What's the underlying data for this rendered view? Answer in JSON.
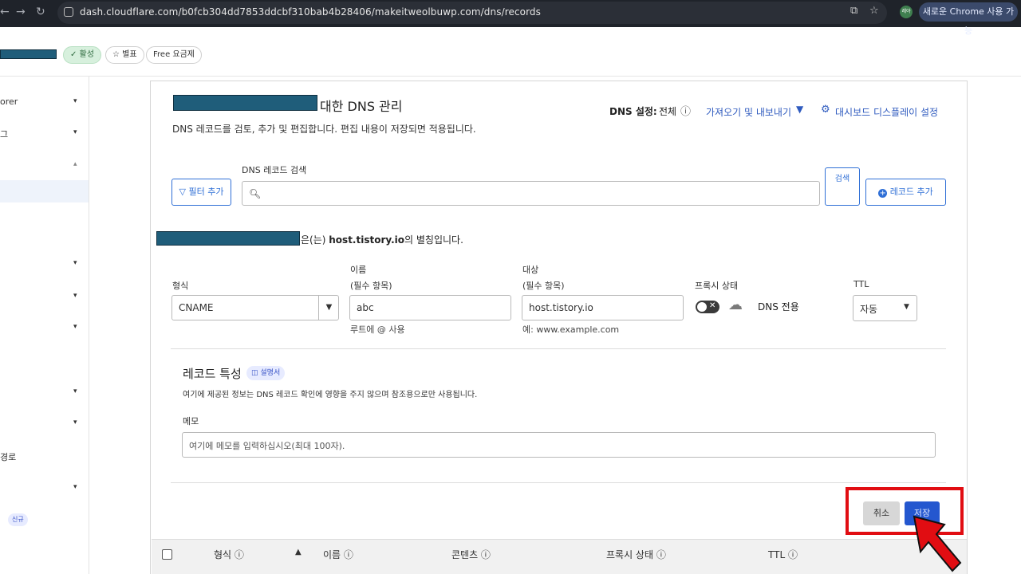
{
  "browser": {
    "url": "dash.cloudflare.com/b0fcb304dd7853ddcbf310bab4b28406/makeitweolbuwp.com/dns/records",
    "profile_initials": "레야",
    "new_chrome_label": "새로운 Chrome 사용 가능"
  },
  "header": {
    "status_active": "✓ 활성",
    "star_label": "☆ 별표",
    "plan_label": "Free 요금제"
  },
  "sidebar": {
    "items": [
      {
        "label": "orer",
        "caret": "▾"
      },
      {
        "label": "그",
        "caret": "▾"
      },
      {
        "label": "",
        "caret": "▴"
      },
      {
        "label": "",
        "caret": "▾"
      },
      {
        "label": "",
        "caret": "▾"
      },
      {
        "label": "",
        "caret": "▾"
      },
      {
        "label": "",
        "caret": "▾"
      },
      {
        "label": "",
        "caret": "▾"
      },
      {
        "label": "경로",
        "caret": ""
      },
      {
        "label": "",
        "caret": "▾"
      }
    ],
    "new_badge": "신규"
  },
  "dns": {
    "title_suffix": "대한 DNS 관리",
    "description": "DNS 레코드를 검토, 추가 및 편집합니다. 편집 내용이 저장되면 적용됩니다.",
    "settings_label": "DNS 설정:",
    "settings_value": "전체",
    "import_export": "가져오기 및 내보내기",
    "dashboard_display": "대시보드 디스플레이 설정",
    "filter_button": "필터 추가",
    "search_label": "DNS 레코드 검색",
    "search_button": "검색",
    "add_record": "레코드 추가",
    "alias_middle": "은(는) ",
    "alias_host": "host.tistory.io",
    "alias_end": "의 별칭입니다."
  },
  "form": {
    "type_label": "형식",
    "type_value": "CNAME",
    "name_label": "이름",
    "name_required": "(필수 항목)",
    "name_value": "abc",
    "name_hint": "루트에 @ 사용",
    "target_label": "대상",
    "target_required": "(필수 항목)",
    "target_value": "host.tistory.io",
    "target_hint": "예: www.example.com",
    "proxy_label": "프록시 상태",
    "proxy_value": "DNS 전용",
    "ttl_label": "TTL",
    "ttl_value": "자동"
  },
  "attributes": {
    "title": "레코드 특성",
    "docs_badge": "설명서",
    "description": "여기에 제공된 정보는 DNS 레코드 확인에 영향을 주지 않으며 참조용으로만 사용됩니다.",
    "memo_label": "메모",
    "memo_placeholder": "여기에 메모를 입력하십시오(최대 100자)."
  },
  "actions": {
    "cancel": "취소",
    "save": "저장"
  },
  "table": {
    "columns": [
      "형식 ⓘ",
      "이름 ⓘ",
      "콘텐츠 ⓘ",
      "프록시 상태 ⓘ",
      "TTL ⓘ"
    ]
  },
  "colors": {
    "accent": "#2457cf",
    "highlight_frame": "#e10d12",
    "pointer_arrow": "#e10d12",
    "redaction": "#1f5d7a"
  }
}
